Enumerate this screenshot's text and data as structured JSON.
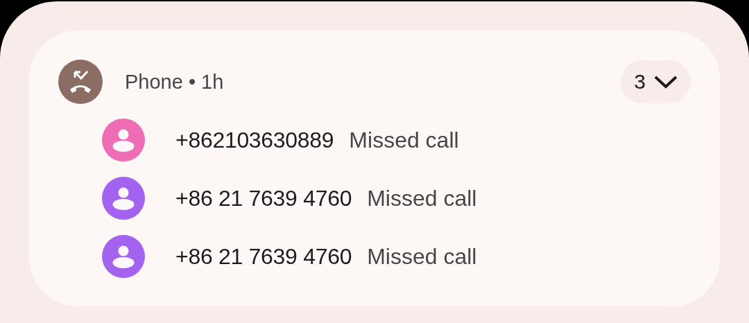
{
  "notification": {
    "app": "Phone",
    "separator": "•",
    "time": "1h",
    "count": "3",
    "messages": [
      {
        "number": "+862103630889",
        "text": "Missed call",
        "color": "#ef6db4"
      },
      {
        "number": "+86 21 7639 4760",
        "text": "Missed call",
        "color": "#a463ef"
      },
      {
        "number": "+86 21 7639 4760",
        "text": "Missed call",
        "color": "#a463ef"
      }
    ]
  }
}
